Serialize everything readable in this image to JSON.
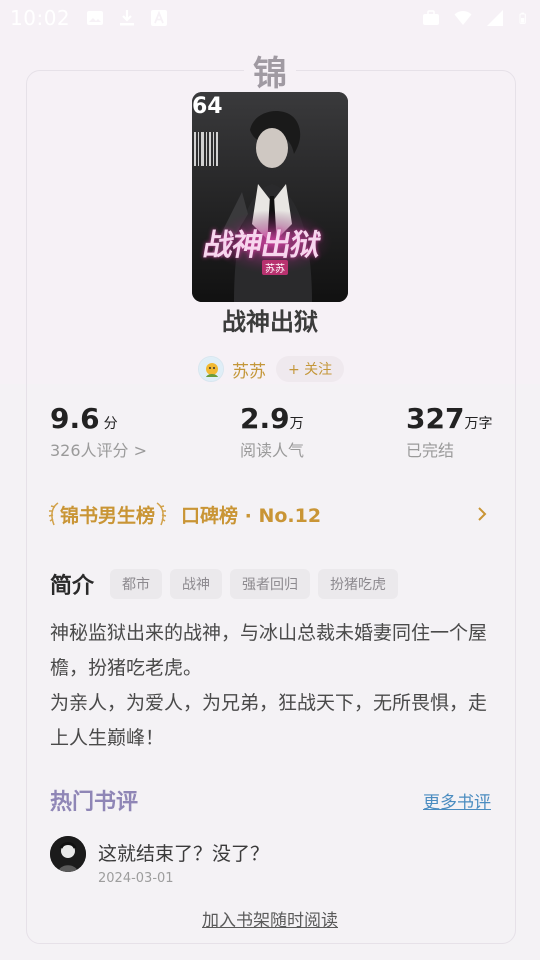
{
  "status_bar": {
    "time": "10:02",
    "left_icons": [
      "image-icon",
      "download-icon",
      "font-icon"
    ],
    "right_icons": [
      "briefcase-icon",
      "wifi-icon",
      "signal-icon",
      "battery-icon"
    ]
  },
  "seal_char": "锦",
  "book": {
    "title": "战神出狱",
    "cover_title": "战神出狱",
    "cover_author": "苏苏",
    "cover_number": "64"
  },
  "author": {
    "name": "苏苏",
    "follow_label": "+ 关注"
  },
  "stats": [
    {
      "value": "9.6",
      "unit": "分",
      "label": "326人评分 >"
    },
    {
      "value": "2.9",
      "unit": "万",
      "label": "阅读人气"
    },
    {
      "value": "327",
      "unit": "万字",
      "label": "已完结"
    }
  ],
  "rank": {
    "badge": "锦书男生榜",
    "text": "口碑榜 · No.12"
  },
  "intro": {
    "title": "简介",
    "tags": [
      "都市",
      "战神",
      "强者回归",
      "扮猪吃虎"
    ],
    "paragraphs": [
      "神秘监狱出来的战神，与冰山总裁未婚妻同住一个屋檐，扮猪吃老虎。",
      "为亲人，为爱人，为兄弟，狂战天下，无所畏惧，走上人生巅峰！"
    ]
  },
  "reviews": {
    "title": "热门书评",
    "more_label": "更多书评",
    "items": [
      {
        "text": "这就结束了？没了？",
        "date": "2024-03-01"
      }
    ]
  },
  "add_shelf_label": "加入书架随时阅读",
  "colors": {
    "gold": "#c99535",
    "review_title": "#8f86b6",
    "link": "#4a8cc0"
  }
}
